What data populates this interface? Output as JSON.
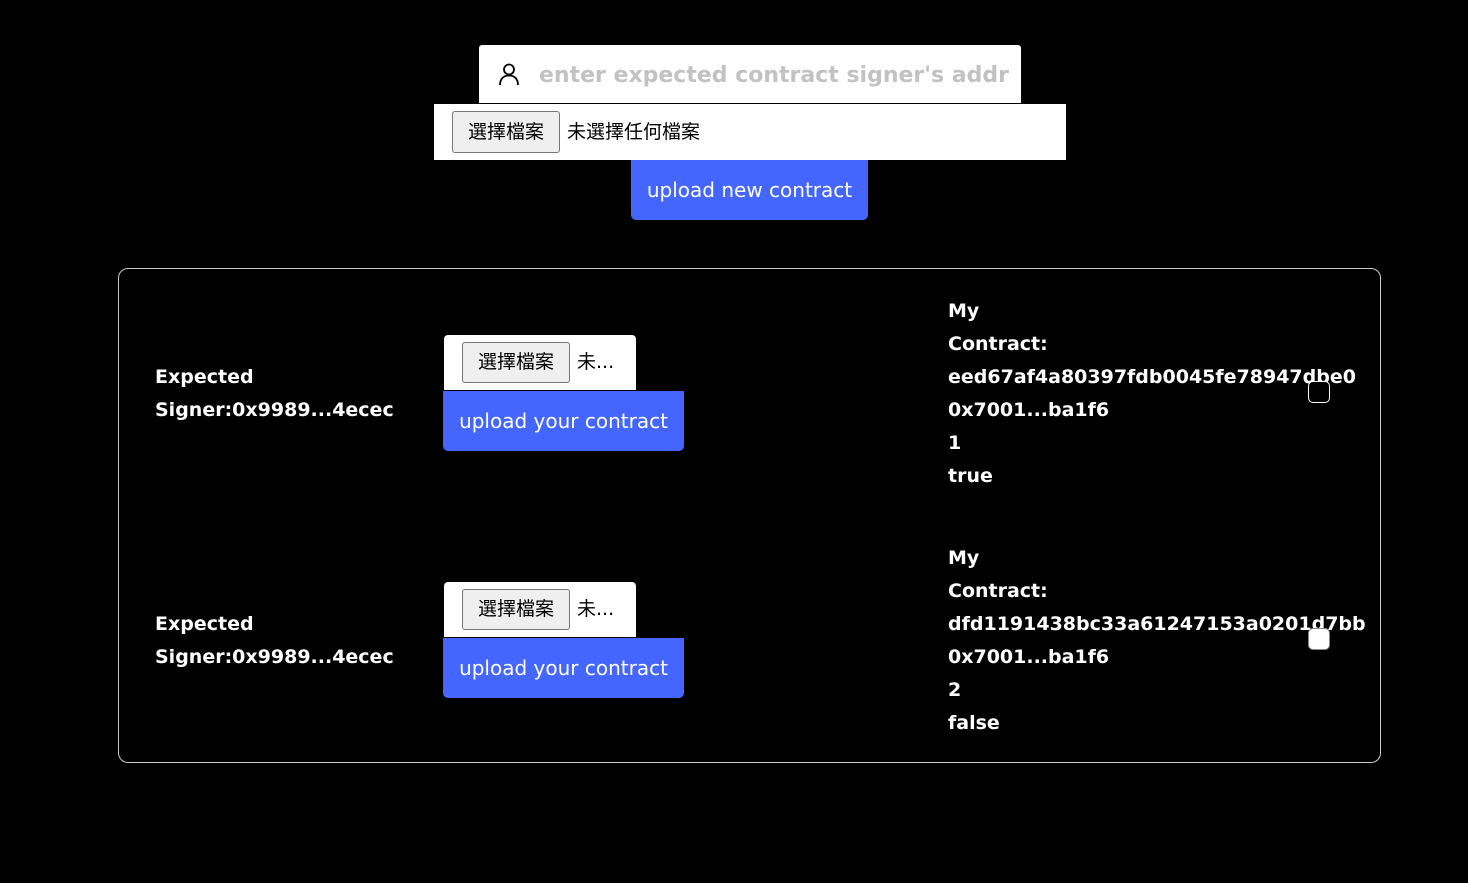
{
  "signer_input": {
    "placeholder": "enter expected contract signer's address",
    "icon": "user-icon"
  },
  "file_picker": {
    "button_label": "選擇檔案",
    "status": "未選擇任何檔案"
  },
  "upload_new_label": "upload new contract",
  "contracts": [
    {
      "expected_label": "Expected",
      "signer_label": "Signer:0x9989...4ecec",
      "file_button": "選擇檔案",
      "file_status": "未...",
      "upload_label": "upload your contract",
      "my_label": "My",
      "contract_label": "Contract:",
      "hash": "eed67af4a80397fdb0045fe78947dbe0",
      "address": "0x7001...ba1f6",
      "index": "1",
      "status": "true"
    },
    {
      "expected_label": "Expected",
      "signer_label": "Signer:0x9989...4ecec",
      "file_button": "選擇檔案",
      "file_status": "未...",
      "upload_label": "upload your contract",
      "my_label": "My",
      "contract_label": "Contract:",
      "hash": "dfd1191438bc33a61247153a0201d7bb",
      "address": "0x7001...ba1f6",
      "index": "2",
      "status": "false"
    }
  ],
  "colors": {
    "accent": "#4466ff",
    "background": "#000000"
  }
}
